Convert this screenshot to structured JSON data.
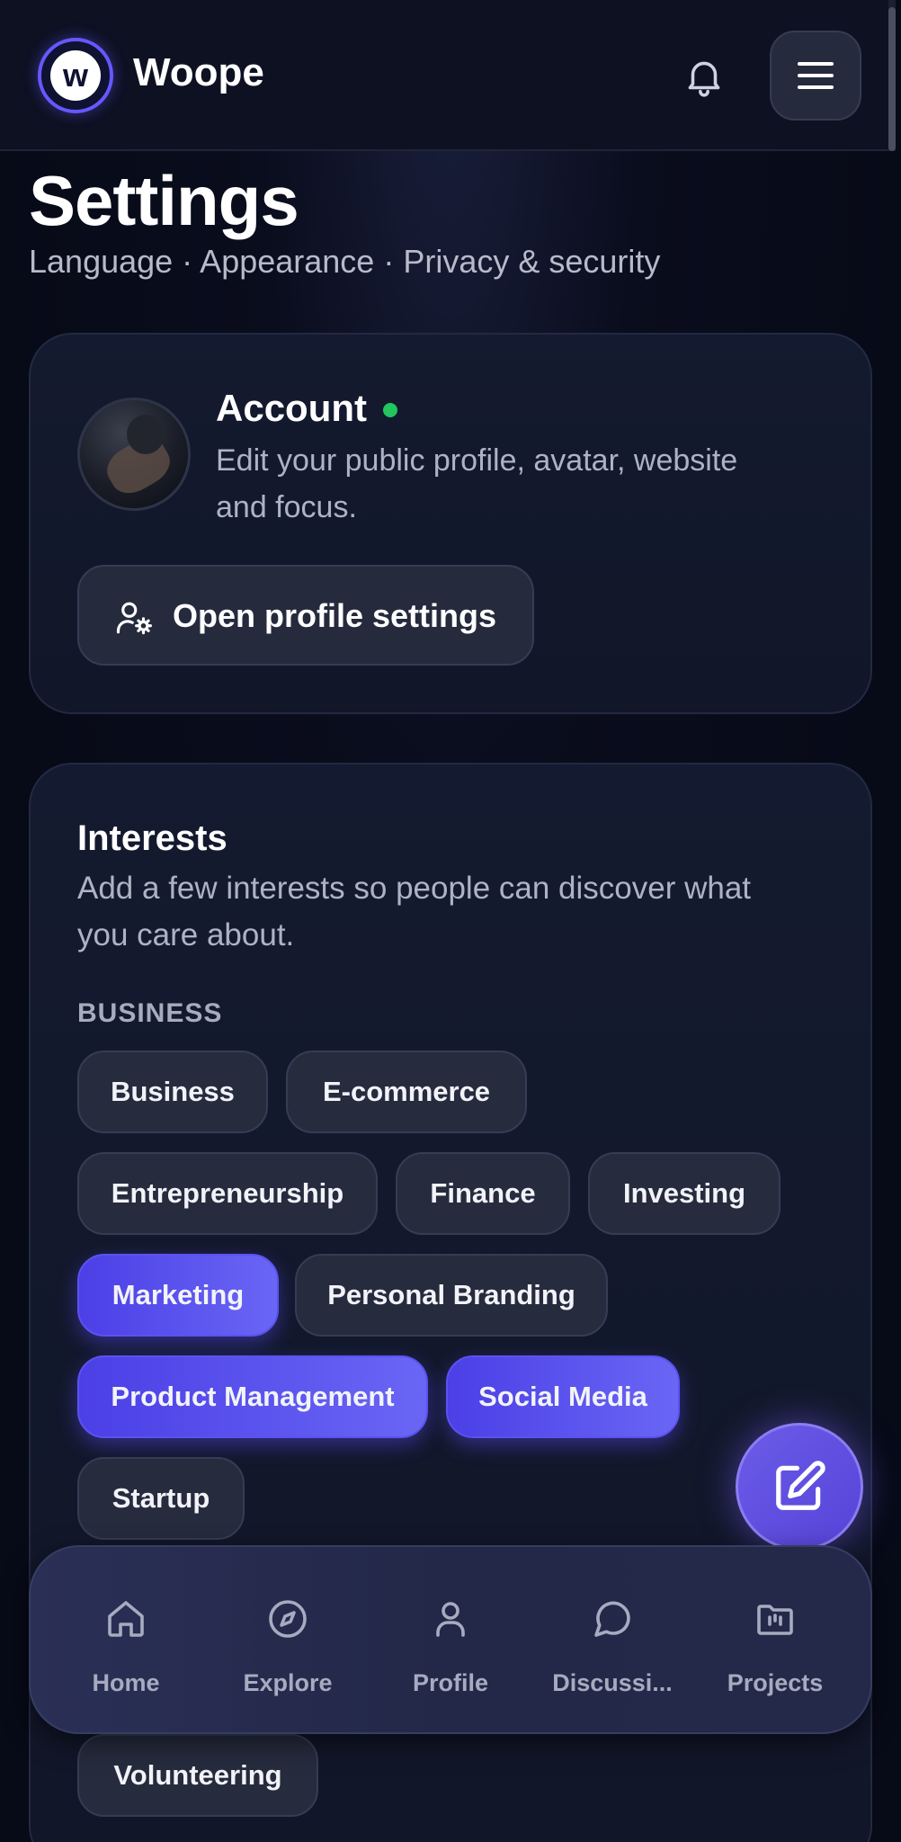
{
  "header": {
    "logo_letter": "w",
    "brand": "Woope",
    "bell_icon": "bell-icon",
    "menu_icon": "hamburger-menu-icon"
  },
  "page": {
    "title": "Settings",
    "subtitle": "Language · Appearance · Privacy & security"
  },
  "account": {
    "title": "Account",
    "status_color": "#22c55e",
    "description": "Edit your public profile, avatar, website and focus.",
    "button_label": "Open profile settings",
    "button_icon": "user-settings-icon"
  },
  "interests": {
    "title": "Interests",
    "description": "Add a few interests so people can discover what you care about.",
    "section_label": "BUSINESS",
    "chips": [
      {
        "label": "Business",
        "selected": false
      },
      {
        "label": "E-commerce",
        "selected": false
      },
      {
        "label": "Entrepreneurship",
        "selected": false
      },
      {
        "label": "Finance",
        "selected": false
      },
      {
        "label": "Investing",
        "selected": false
      },
      {
        "label": "Marketing",
        "selected": true
      },
      {
        "label": "Personal Branding",
        "selected": false
      },
      {
        "label": "Product Management",
        "selected": true
      },
      {
        "label": "Social Media",
        "selected": true
      },
      {
        "label": "Startup",
        "selected": false
      },
      {
        "label": "Volunteering",
        "selected": false
      }
    ]
  },
  "fab": {
    "icon": "edit-icon"
  },
  "nav": {
    "items": [
      {
        "label": "Home",
        "icon": "home-icon"
      },
      {
        "label": "Explore",
        "icon": "compass-icon"
      },
      {
        "label": "Profile",
        "icon": "user-icon"
      },
      {
        "label": "Discussi...",
        "icon": "chat-icon"
      },
      {
        "label": "Projects",
        "icon": "folder-icon"
      }
    ]
  },
  "colors": {
    "accent": "#5b4ff0",
    "background": "#070a17"
  }
}
